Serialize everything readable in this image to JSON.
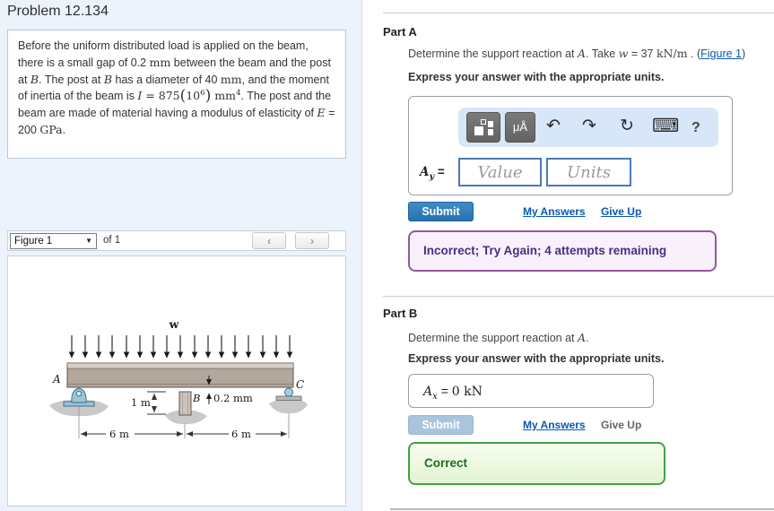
{
  "left_panel": {
    "title": "Problem 12.134",
    "statement": [
      {
        "t": "Before the uniform distributed load is applied on the beam, there is a small gap of 0.2 "
      },
      {
        "t": "mm",
        "c": "mr"
      },
      {
        "t": " between the beam and the post at "
      },
      {
        "t": "B",
        "c": "m"
      },
      {
        "t": ". The post at "
      },
      {
        "t": "B",
        "c": "m"
      },
      {
        "t": " has a diameter of 40 "
      },
      {
        "t": "mm",
        "c": "mr"
      },
      {
        "t": ", and the moment of inertia of the beam is "
      },
      {
        "t": "I",
        "c": "m"
      },
      {
        "t": " = 875",
        "c": "mr"
      },
      {
        "t": "(",
        "c": "bigp"
      },
      {
        "t": "10",
        "c": "mr"
      },
      {
        "t": "6",
        "c": "sup"
      },
      {
        "t": ")",
        "c": "bigp"
      },
      {
        "t": " mm",
        "c": "mr"
      },
      {
        "t": "4",
        "c": "sup"
      },
      {
        "t": ". The post and the beam are made of material having a modulus of elasticity of "
      },
      {
        "t": "E",
        "c": "m"
      },
      {
        "t": " = 200 "
      },
      {
        "t": "GPa",
        "c": "mr"
      },
      {
        "t": "."
      }
    ],
    "figure_bar": {
      "selector_value": "Figure 1",
      "caret": "▼",
      "of_text": "of 1",
      "prev_icon": "‹",
      "next_icon": "›"
    },
    "figure": {
      "labels": {
        "load": "w",
        "support_a": "A",
        "post_b": "B",
        "support_c": "C",
        "post_height": "1 m",
        "gap": "0.2 mm",
        "span_left": "6 m",
        "span_right": "6 m"
      }
    }
  },
  "part_a": {
    "heading": "Part A",
    "question_pre": [
      {
        "t": "Determine the support reaction at "
      },
      {
        "t": "A",
        "c": "m"
      },
      {
        "t": ". Take "
      },
      {
        "t": "w",
        "c": "m"
      },
      {
        "t": " = 37 "
      },
      {
        "t": "kN/m",
        "c": "mr"
      },
      {
        "t": " . ("
      }
    ],
    "figure_link": "Figure 1",
    "question_suffix": ")",
    "express": "Express your answer with the appropriate units.",
    "toolbar": {
      "units_button_label": "μÅ",
      "undo_icon": "↶",
      "redo_icon": "↷",
      "reset_icon": "↻",
      "keyboard_icon": "⌨",
      "help_label": "?"
    },
    "answer_label": [
      {
        "t": "A",
        "c": "m b"
      },
      {
        "t": "y",
        "c": "sub b"
      },
      {
        "t": " = ",
        "c": "b"
      }
    ],
    "value_placeholder": "Value",
    "units_placeholder": "Units",
    "submit_label": "Submit",
    "my_answers_label": "My Answers",
    "give_up_label": "Give Up",
    "feedback": "Incorrect; Try Again; 4 attempts remaining"
  },
  "part_b": {
    "heading": "Part B",
    "question": [
      {
        "t": "Determine the support reaction at "
      },
      {
        "t": "A",
        "c": "m"
      },
      {
        "t": "."
      }
    ],
    "express": "Express your answer with the appropriate units.",
    "answer_value": [
      {
        "t": "A",
        "c": "m"
      },
      {
        "t": "x",
        "c": "sub"
      },
      {
        "t": " =  ",
        "c": ""
      },
      {
        "t": "0 kN",
        "c": "mr"
      }
    ],
    "submit_label": "Submit",
    "my_answers_label": "My Answers",
    "give_up_label": "Give Up",
    "feedback": "Correct"
  },
  "colors": {
    "accent_blue": "#2672ae",
    "panel_blue": "#edf3fa",
    "incorrect_purple": "#95589f",
    "correct_green": "#43a143",
    "link_blue": "#0a58b0"
  }
}
